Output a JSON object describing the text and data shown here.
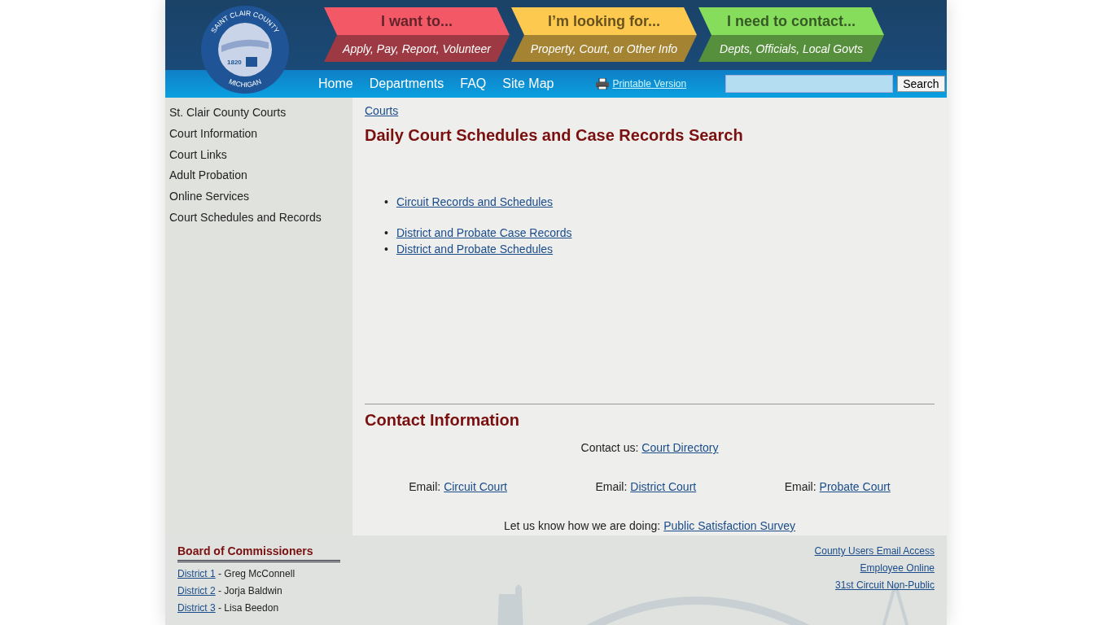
{
  "logo": {
    "top_text": "SAINT CLAIR COUNTY",
    "year": "1820",
    "bottom_text": "MICHIGAN"
  },
  "quick_links": [
    {
      "title": "I want to...",
      "subtitle": "Apply, Pay, Report, Volunteer",
      "color": "#f25866"
    },
    {
      "title": "I’m looking for...",
      "subtitle": "Property, Court, or Other Info",
      "color": "#fdc94f"
    },
    {
      "title": "I need to contact...",
      "subtitle": "Depts, Officials, Local Govts",
      "color": "#86dd5c"
    }
  ],
  "nav": [
    "Home",
    "Departments",
    "FAQ",
    "Site Map"
  ],
  "printable": "Printable Version",
  "search": {
    "button": "Search"
  },
  "sidebar": [
    "St. Clair County Courts",
    "Court Information",
    "Court Links",
    "Adult Probation",
    "Online Services",
    "Court Schedules and Records"
  ],
  "breadcrumb": "Courts",
  "title": "Daily Court Schedules and Case Records Search",
  "bullet": "•",
  "link_groups": [
    [
      "Circuit Records and Schedules"
    ],
    [
      "District and Probate Case Records",
      "District and Probate Schedules"
    ]
  ],
  "contact": {
    "heading": "Contact Information",
    "contact_label": "Contact us:",
    "contact_link": "Court Directory",
    "emails": [
      {
        "label": "Email:",
        "link": "Circuit Court"
      },
      {
        "label": "Email:",
        "link": "District Court"
      },
      {
        "label": "Email:",
        "link": "Probate Court"
      }
    ],
    "survey_label": "Let us know how we are doing:",
    "survey_link": "Public Satisfaction Survey"
  },
  "footer": {
    "heading": "Board of Commissioners",
    "commissioners": [
      {
        "district": "District 1",
        "name": "- Greg McConnell"
      },
      {
        "district": "District 2",
        "name": "- Jorja Baldwin"
      },
      {
        "district": "District 3",
        "name": "- Lisa Beedon"
      }
    ],
    "links": [
      "County Users Email Access",
      "Employee Online",
      "31st Circuit Non-Public"
    ]
  }
}
